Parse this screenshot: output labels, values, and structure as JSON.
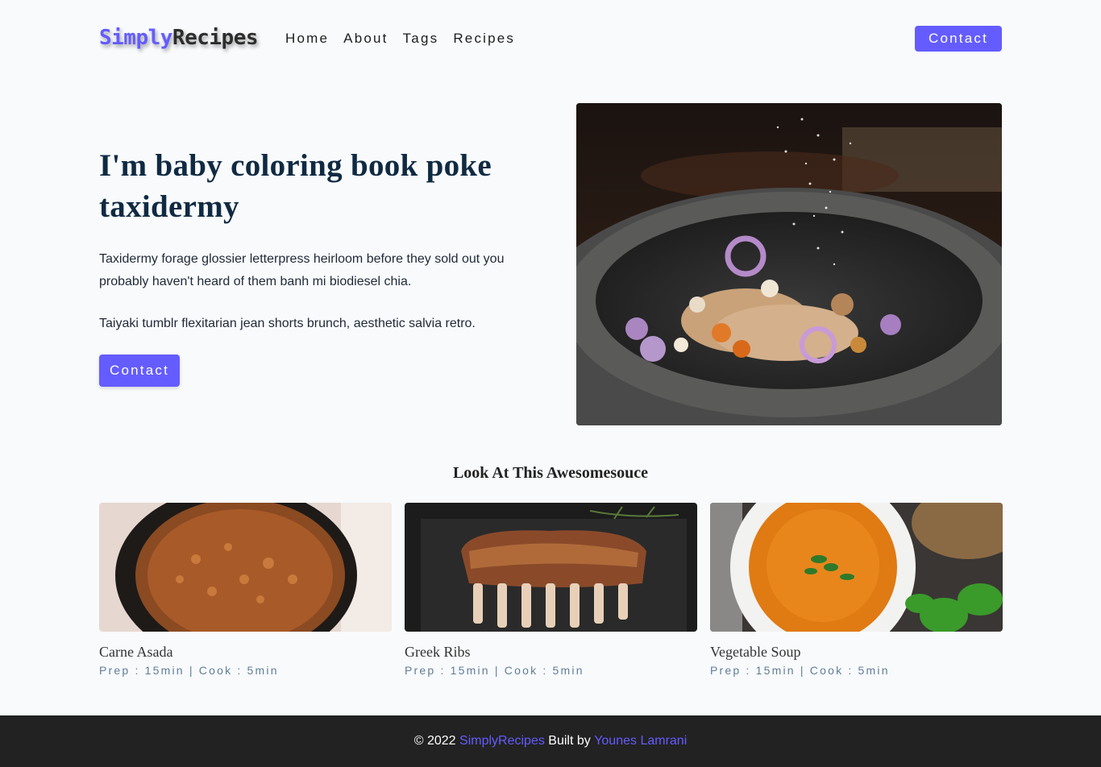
{
  "nav": {
    "logo_part1": "Simply",
    "logo_part2": "Recipes",
    "links": [
      "Home",
      "About",
      "Tags",
      "Recipes"
    ],
    "contact_label": "Contact"
  },
  "hero": {
    "title": "I'm baby coloring book poke taxidermy",
    "paragraph1": "Taxidermy forage glossier letterpress heirloom before they sold out you probably haven't heard of them banh mi biodiesel chia.",
    "paragraph2": "Taiyaki tumblr flexitarian jean shorts brunch, aesthetic salvia retro.",
    "button_label": "Contact"
  },
  "featured": {
    "title": "Look At This Awesomesouce",
    "recipes": [
      {
        "name": "Carne Asada",
        "meta": "Prep : 15min | Cook : 5min"
      },
      {
        "name": "Greek Ribs",
        "meta": "Prep : 15min | Cook : 5min"
      },
      {
        "name": "Vegetable Soup",
        "meta": "Prep : 15min | Cook : 5min"
      }
    ]
  },
  "footer": {
    "prefix": "© 2022 ",
    "brand": "SimplyRecipes",
    "middle": " Built by ",
    "author": "Younes Lamrani"
  },
  "colors": {
    "accent": "#645cff",
    "background": "#f8fafc",
    "footer_bg": "#222222"
  }
}
